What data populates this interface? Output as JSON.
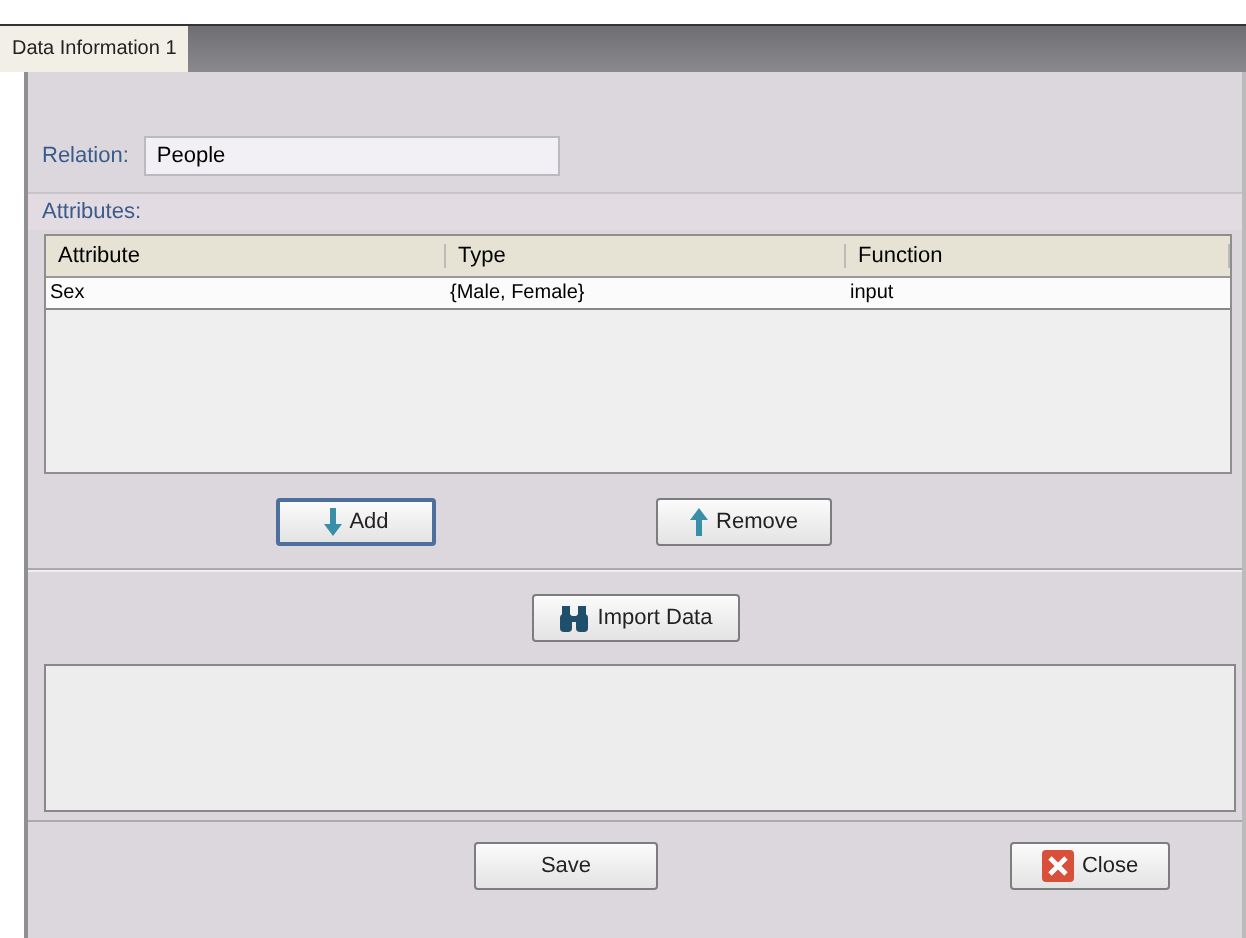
{
  "tabs": [
    {
      "label": "Data Information 1",
      "selected": true
    }
  ],
  "relation": {
    "label": "Relation:",
    "value": "People"
  },
  "attributes": {
    "label": "Attributes:",
    "columns": [
      "Attribute",
      "Type",
      "Function"
    ],
    "rows": [
      {
        "cells": [
          "Sex",
          "{Male, Female}",
          "input"
        ],
        "selected": true
      }
    ]
  },
  "list_buttons": [
    {
      "label": "Add",
      "kind": "add"
    },
    {
      "label": "Remove",
      "kind": "remove"
    }
  ],
  "import_button": {
    "label": "Import Data"
  },
  "footer_buttons": [
    {
      "label": "Save",
      "kind": "save"
    },
    {
      "label": "Close",
      "kind": "close"
    }
  ]
}
